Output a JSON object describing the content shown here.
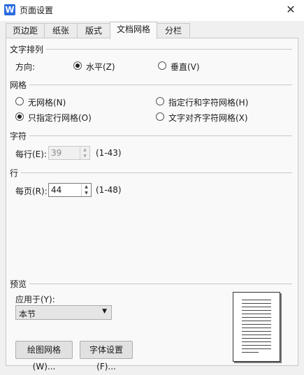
{
  "window": {
    "title": "页面设置",
    "app_icon_letter": "W",
    "close_glyph": "✕"
  },
  "tabs": [
    {
      "label": "页边距"
    },
    {
      "label": "纸张"
    },
    {
      "label": "版式"
    },
    {
      "label": "文档网格",
      "active": true
    },
    {
      "label": "分栏"
    }
  ],
  "text_direction": {
    "section": "文字排列",
    "direction_label": "方向:",
    "horizontal": "水平(Z)",
    "vertical": "垂直(V)",
    "selected": "horizontal"
  },
  "grid": {
    "section": "网格",
    "no_grid": "无网格(N)",
    "line_and_char": "指定行和字符网格(H)",
    "line_only": "只指定行网格(O)",
    "snap_chars": "文字对齐字符网格(X)",
    "selected": "line_only"
  },
  "chars": {
    "section": "字符",
    "per_line_label": "每行(E):",
    "value": "39",
    "range": "(1-43)"
  },
  "lines": {
    "section": "行",
    "per_page_label": "每页(R):",
    "value": "44",
    "range": "(1-48)"
  },
  "preview": {
    "section": "预览",
    "apply_label": "应用于(Y):",
    "apply_value": "本节",
    "lines": 16
  },
  "buttons": {
    "draw_grid": "绘图网格(W)...",
    "font_settings": "字体设置(F)..."
  }
}
